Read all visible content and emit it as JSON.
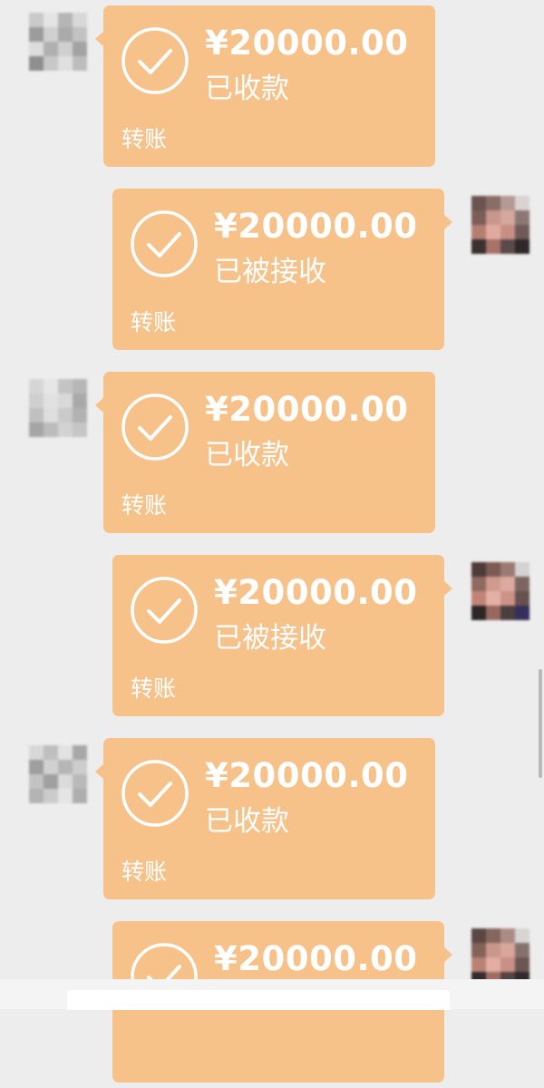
{
  "messages": [
    {
      "direction": "incoming",
      "amount": "¥20000.00",
      "status": "已收款",
      "label": "转账"
    },
    {
      "direction": "outgoing",
      "amount": "¥20000.00",
      "status": "已被接收",
      "label": "转账"
    },
    {
      "direction": "incoming",
      "amount": "¥20000.00",
      "status": "已收款",
      "label": "转账"
    },
    {
      "direction": "outgoing",
      "amount": "¥20000.00",
      "status": "已被接收",
      "label": "转账"
    },
    {
      "direction": "incoming",
      "amount": "¥20000.00",
      "status": "已收款",
      "label": "转账"
    },
    {
      "direction": "outgoing",
      "amount": "¥20000.00",
      "status": "",
      "label": ""
    }
  ],
  "colors": {
    "background": "#ededed",
    "bubble": "#f7c28a",
    "text": "#ffffff"
  },
  "icons": {
    "transfer_status": "check-circle-icon",
    "avatar": "pixelated-avatar"
  }
}
